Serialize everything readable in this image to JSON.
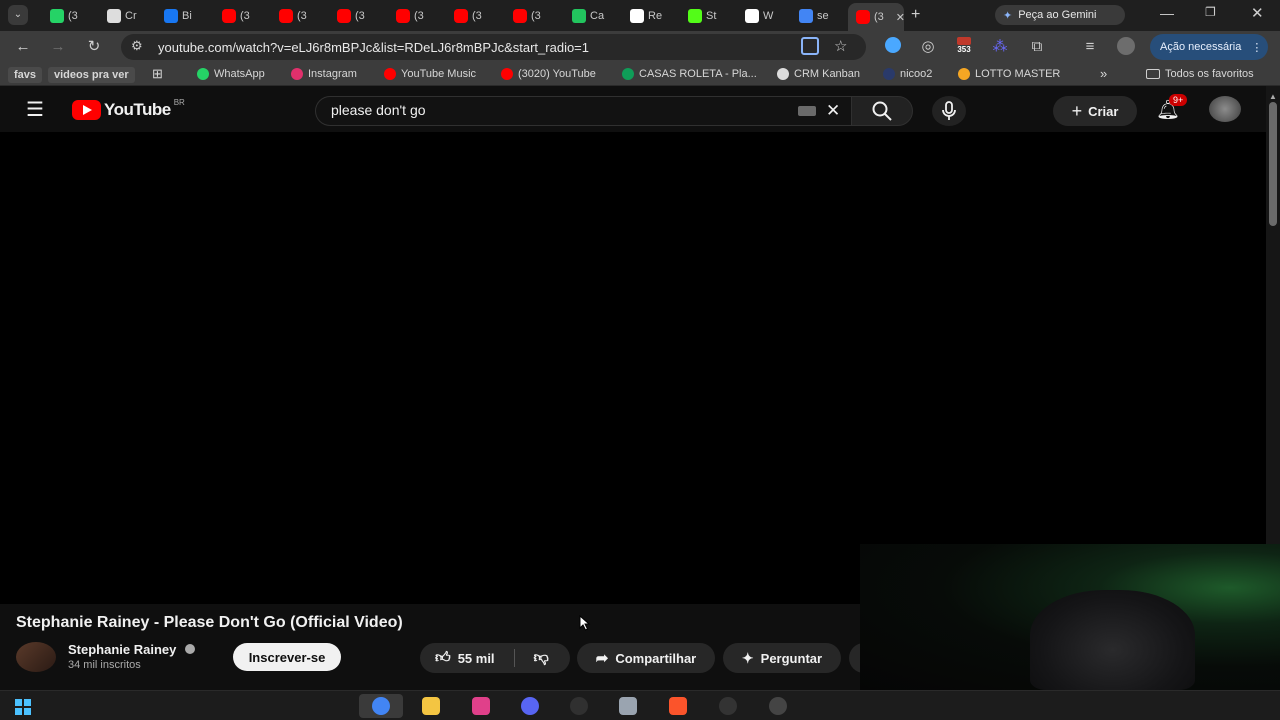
{
  "browser": {
    "tabs": [
      {
        "label": "(3",
        "icon": "whatsapp-icon",
        "color": "#25d366"
      },
      {
        "label": "Cr",
        "icon": "crm-icon",
        "color": "#dddddd"
      },
      {
        "label": "Bi",
        "icon": "meta-icon",
        "color": "#1877f2"
      },
      {
        "label": "(3",
        "icon": "youtube-icon",
        "color": "#ff0000"
      },
      {
        "label": "(3",
        "icon": "youtube-icon",
        "color": "#ff0000"
      },
      {
        "label": "(3",
        "icon": "youtube-icon",
        "color": "#ff0000"
      },
      {
        "label": "(3",
        "icon": "youtube-icon",
        "color": "#ff0000"
      },
      {
        "label": "(3",
        "icon": "youtube-icon",
        "color": "#ff0000"
      },
      {
        "label": "(3",
        "icon": "youtube-icon",
        "color": "#ff0000"
      },
      {
        "label": "Ca",
        "icon": "clover-icon",
        "color": "#22c55e"
      },
      {
        "label": "Re",
        "icon": "magnet-icon",
        "color": "#ffffff"
      },
      {
        "label": "St",
        "icon": "kick-icon",
        "color": "#53fc18"
      },
      {
        "label": "W",
        "icon": "diamond-icon",
        "color": "#ffffff"
      },
      {
        "label": "se",
        "icon": "google-icon",
        "color": "#4285f4"
      },
      {
        "label": "(3",
        "icon": "youtube-icon",
        "color": "#ff0000"
      }
    ],
    "gemini_label": "Peça ao Gemini",
    "url": "youtube.com/watch?v=eLJ6r8mBPJc&list=RDeLJ6r8mBPJc&start_radio=1",
    "extension_badge": "353",
    "action_needed": "Ação necessária",
    "bookmarks": [
      {
        "label": "favs",
        "icon": ""
      },
      {
        "label": "videos pra ver",
        "icon": ""
      },
      {
        "label": "WhatsApp",
        "icon": "whatsapp-icon",
        "color": "#25d366"
      },
      {
        "label": "Instagram",
        "icon": "instagram-icon",
        "color": "#e1306c"
      },
      {
        "label": "YouTube Music",
        "icon": "youtube-music-icon",
        "color": "#ff0000"
      },
      {
        "label": "(3020) YouTube",
        "icon": "youtube-icon",
        "color": "#ff0000"
      },
      {
        "label": "CASAS ROLETA - Pla...",
        "icon": "sheets-icon",
        "color": "#0f9d58"
      },
      {
        "label": "CRM Kanban",
        "icon": "crm-icon",
        "color": "#dddddd"
      },
      {
        "label": "nicoo2",
        "icon": "nicoo-icon",
        "color": "#2a3a6a"
      },
      {
        "label": "LOTTO MASTER",
        "icon": "lotto-icon",
        "color": "#f5a623"
      }
    ],
    "all_favorites": "Todos os favoritos"
  },
  "youtube": {
    "logo_text": "YouTube",
    "region": "BR",
    "search_value": "please don't go",
    "create_label": "Criar",
    "notifications_badge": "9+"
  },
  "video": {
    "title": "Stephanie Rainey - Please Don't Go (Official Video)",
    "channel": "Stephanie Rainey",
    "subscribers": "34 mil inscritos",
    "subscribe_label": "Inscrever-se",
    "likes": "55 mil",
    "share_label": "Compartilhar",
    "ask_label": "Perguntar"
  },
  "taskbar": {
    "apps": [
      {
        "icon": "chrome-icon",
        "color": "#4285f4",
        "active": true
      },
      {
        "icon": "folder-icon",
        "color": "#f4c542"
      },
      {
        "icon": "app-pink-icon",
        "color": "#e0408a"
      },
      {
        "icon": "discord-icon",
        "color": "#5865f2"
      },
      {
        "icon": "obs-icon",
        "color": "#303030"
      },
      {
        "icon": "notepad-icon",
        "color": "#9aa4b0"
      },
      {
        "icon": "brave-icon",
        "color": "#fb542b"
      },
      {
        "icon": "steam-icon",
        "color": "#333333"
      },
      {
        "icon": "cc-icon",
        "color": "#444444"
      }
    ]
  }
}
